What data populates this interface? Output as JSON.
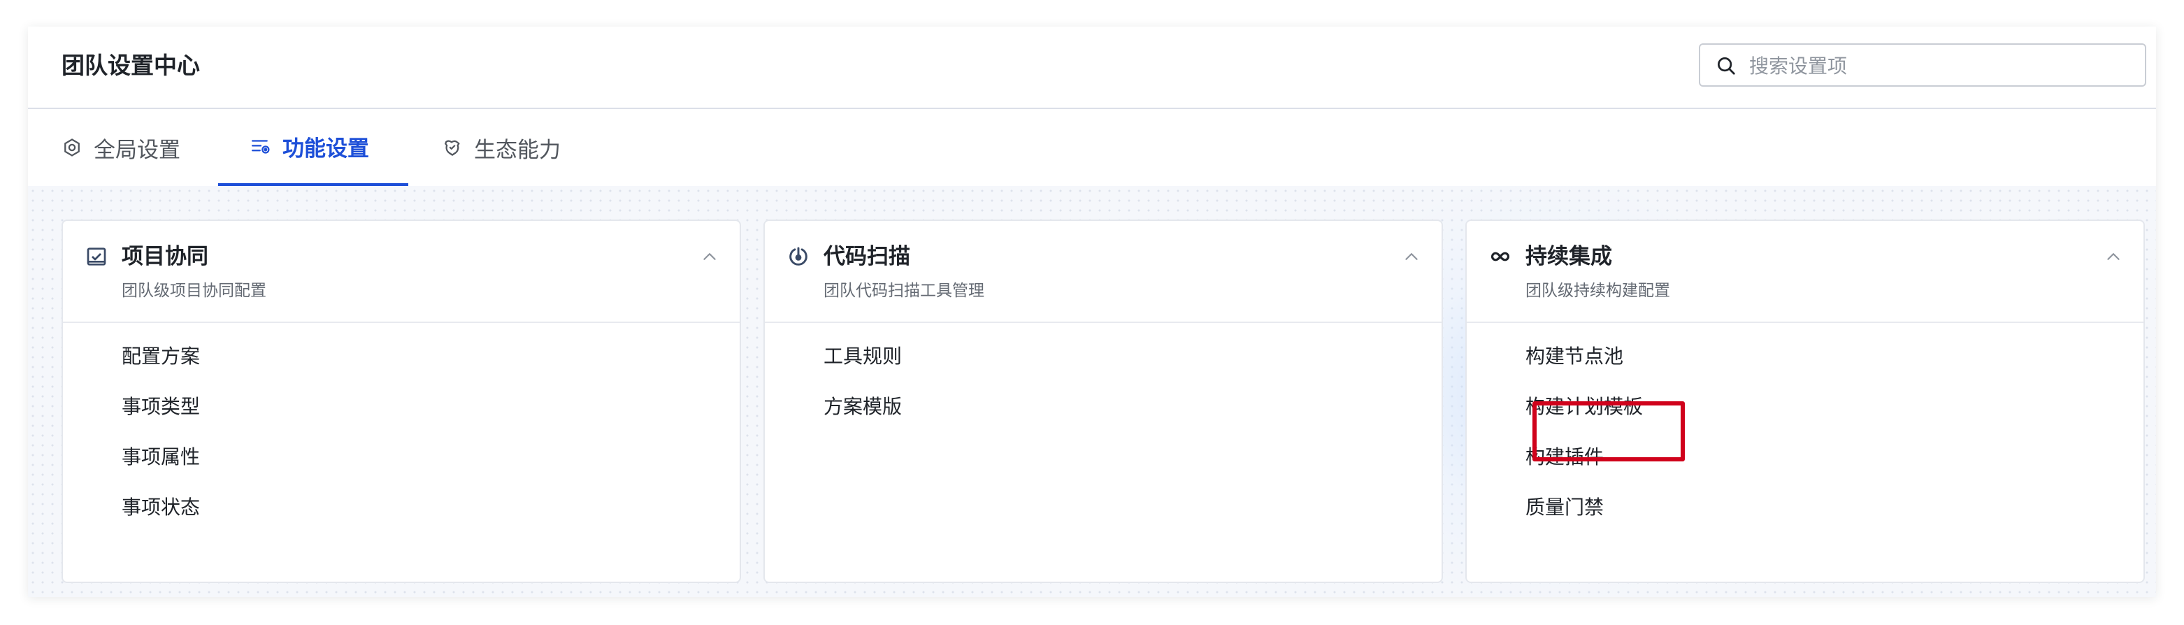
{
  "header": {
    "title": "团队设置中心",
    "search": {
      "placeholder": "搜索设置项",
      "value": ""
    }
  },
  "tabs": [
    {
      "label": "全局设置",
      "icon": "gear-icon",
      "active": false
    },
    {
      "label": "功能设置",
      "icon": "feature-settings-icon",
      "active": true
    },
    {
      "label": "生态能力",
      "icon": "ecosystem-icon",
      "active": false
    }
  ],
  "cards": [
    {
      "title": "项目协同",
      "subtitle": "团队级项目协同配置",
      "icon": "project-board-icon",
      "items": [
        "配置方案",
        "事项类型",
        "事项属性",
        "事项状态"
      ]
    },
    {
      "title": "代码扫描",
      "subtitle": "团队代码扫描工具管理",
      "icon": "scan-icon",
      "items": [
        "工具规则",
        "方案模版"
      ]
    },
    {
      "title": "持续集成",
      "subtitle": "团队级持续构建配置",
      "icon": "infinity-icon",
      "items": [
        "构建节点池",
        "构建计划模板",
        "构建插件",
        "质量门禁"
      ]
    }
  ],
  "highlighted_item": "构建计划模板",
  "colors": {
    "accent": "#1d4fd8",
    "highlight": "#d0021b",
    "text": "#1f2329",
    "muted": "#646a73"
  }
}
